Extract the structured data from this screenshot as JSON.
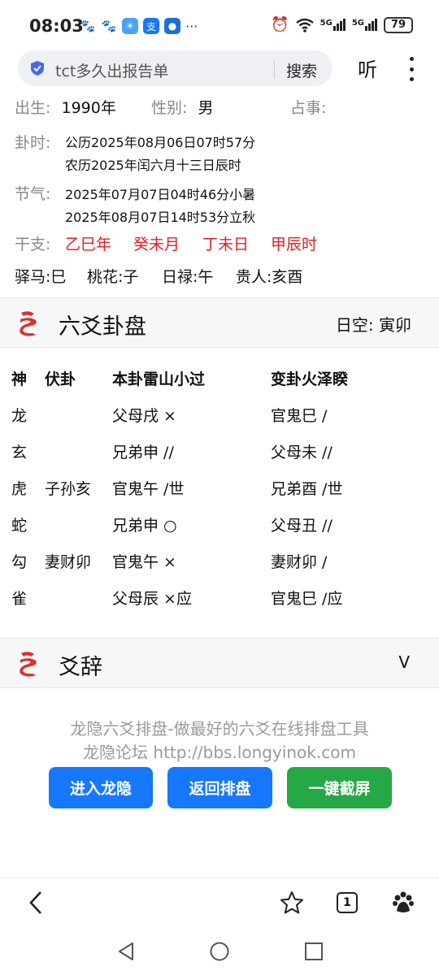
{
  "status": {
    "time": "08:03",
    "network1": "5G",
    "network2": "5G",
    "battery": "79"
  },
  "browser": {
    "url_text": "tct多久出报告单",
    "search_label": "搜索",
    "listen_label": "听"
  },
  "info": {
    "birth_label": "出生:",
    "birth_value": "1990年",
    "gender_label": "性别:",
    "gender_value": "男",
    "matter_label": "占事:",
    "time_label": "卦时:",
    "time_solar": "公历2025年08月06日07时57分",
    "time_lunar": "农历2025年闰六月十三日辰时",
    "solar_term_label": "节气:",
    "solar_term_1": "2025年07月07日04时46分小暑",
    "solar_term_2": "2025年08月07日14时53分立秋",
    "ganzhi_label": "干支:",
    "ganzhi": [
      "乙巳年",
      "癸未月",
      "丁未日",
      "甲辰时"
    ],
    "stars": [
      "驿马:巳",
      "桃花:子",
      "日禄:午",
      "贵人:亥酉"
    ]
  },
  "hexagram_section": {
    "title": "六爻卦盘",
    "void": "日空: 寅卯"
  },
  "table": {
    "headers": [
      "神",
      "伏卦",
      "本卦雷山小过",
      "变卦火泽睽"
    ],
    "rows": [
      {
        "god": "龙",
        "hidden": "",
        "main": "父母戌 ×",
        "changed": "官鬼巳 /"
      },
      {
        "god": "玄",
        "hidden": "",
        "main": "兄弟申 //",
        "changed": "父母未 //"
      },
      {
        "god": "虎",
        "hidden": "子孙亥",
        "main": "官鬼午 /世",
        "changed": "兄弟酉 /世"
      },
      {
        "god": "蛇",
        "hidden": "",
        "main": "兄弟申 ○",
        "changed": "父母丑 //"
      },
      {
        "god": "勾",
        "hidden": "妻财卯",
        "main": "官鬼午 ×",
        "changed": "妻财卯 /"
      },
      {
        "god": "雀",
        "hidden": "",
        "main": "父母辰 ×应",
        "changed": "官鬼巳 /应"
      }
    ]
  },
  "yaoci_section": {
    "title": "爻辞",
    "toggle": "V"
  },
  "footer": {
    "line1": "龙隐六爻排盘-做最好的六爻在线排盘工具",
    "line2": "龙隐论坛 http://bbs.longyinok.com",
    "btn_enter": "进入龙隐",
    "btn_back": "返回排盘",
    "btn_screenshot": "一键截屏"
  },
  "toolbar": {
    "tab_count": "1"
  },
  "colors": {
    "accent_blue": "#1677ff",
    "accent_green": "#27a846",
    "ganzhi_red": "#e02020",
    "dragon_red": "#d8312c"
  }
}
